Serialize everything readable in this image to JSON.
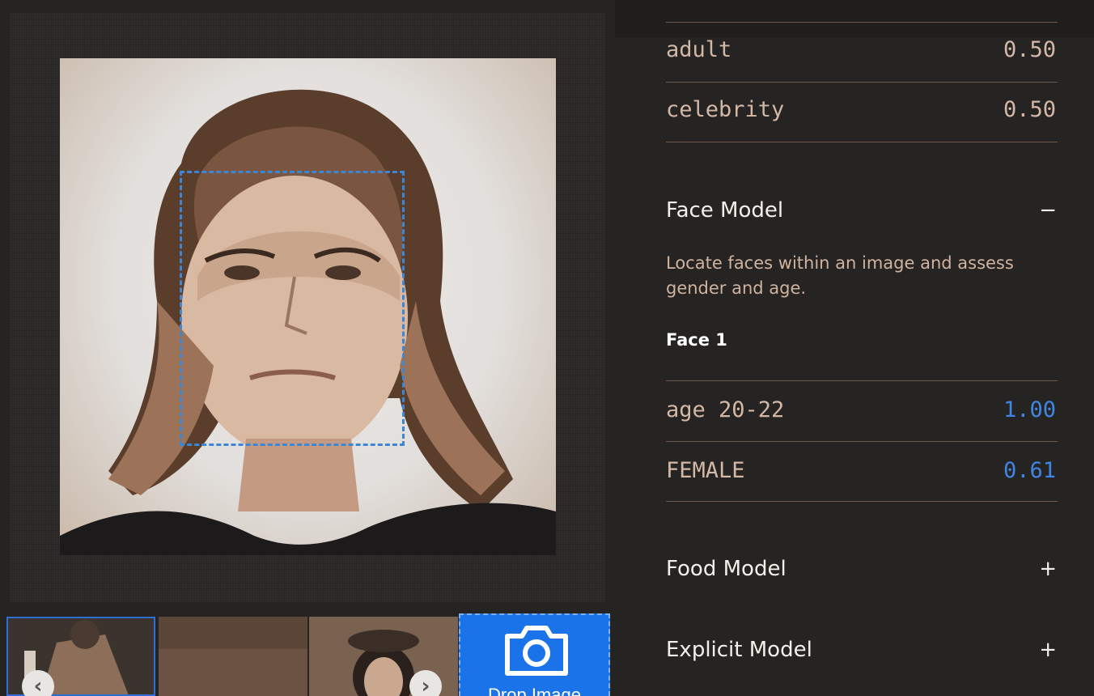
{
  "main_image": {
    "description_icon": "portrait-photo",
    "face_box_color": "#3d86d6"
  },
  "thumbnails": [
    {
      "name": "thumbnail-1",
      "selected": true
    },
    {
      "name": "thumbnail-2",
      "selected": false
    },
    {
      "name": "thumbnail-3",
      "selected": false
    }
  ],
  "nav": {
    "prev_icon": "chevron-left-icon",
    "prev_glyph": "‹",
    "next_icon": "chevron-right-icon",
    "next_glyph": "›"
  },
  "drop_zone": {
    "label": "Drop Image",
    "icon": "camera-icon",
    "color": "#1a73e8"
  },
  "general_scores": [
    {
      "label": "adult",
      "value": "0.50"
    },
    {
      "label": "celebrity",
      "value": "0.50"
    }
  ],
  "face_model": {
    "title": "Face Model",
    "toggle": "−",
    "description": "Locate faces within an image and assess gender and age.",
    "face_label": "Face 1",
    "results": [
      {
        "label": "age 20-22",
        "value": "1.00"
      },
      {
        "label": "FEMALE",
        "value": "0.61"
      }
    ],
    "value_color": "#3f86e4"
  },
  "food_model": {
    "title": "Food Model",
    "toggle": "+"
  },
  "explicit_model": {
    "title": "Explicit Model",
    "toggle": "+"
  }
}
